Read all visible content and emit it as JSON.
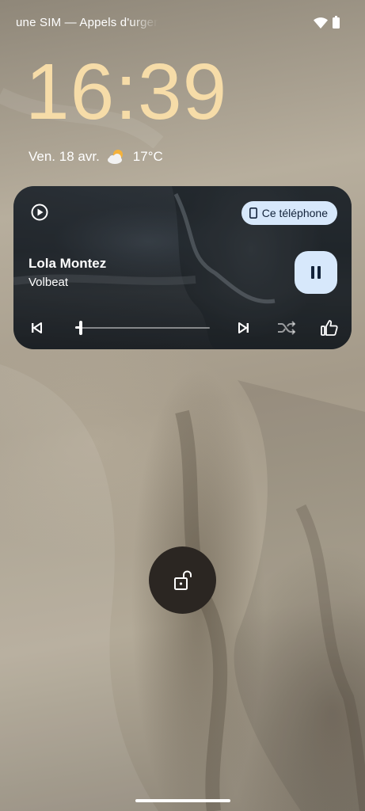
{
  "status_bar": {
    "carrier": "une SIM — Appels d'urgence",
    "wifi_icon": "wifi-icon",
    "battery_icon": "battery-icon"
  },
  "clock": {
    "time": "16:39",
    "color": "#f6dca8"
  },
  "date_weather": {
    "date": "Ven. 18 avr.",
    "weather_icon": "partly-cloudy-icon",
    "temperature": "17°C"
  },
  "media": {
    "app_icon": "play-circle-icon",
    "output_device": "Ce téléphone",
    "title": "Lola Montez",
    "artist": "Volbeat",
    "progress": 0.03,
    "accent": "#d7e8fb",
    "controls": [
      "previous-icon",
      "pause-icon",
      "next-icon",
      "shuffle-icon",
      "thumb-up-icon"
    ]
  },
  "lock": {
    "icon": "unlock-icon",
    "background": "#2b2622"
  }
}
